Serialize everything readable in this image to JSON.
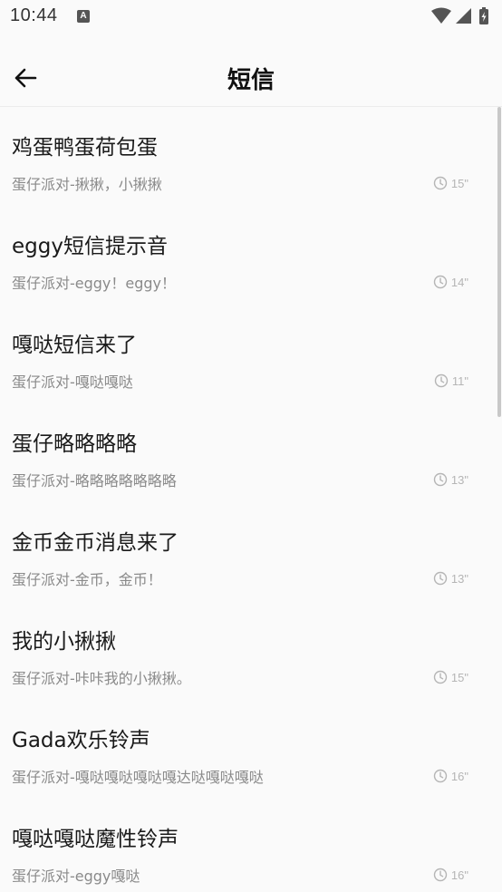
{
  "status_bar": {
    "time": "10:44",
    "notification_icon_letter": "A",
    "icons": [
      "wifi-icon",
      "cellular-signal-icon",
      "battery-charging-icon"
    ]
  },
  "app_bar": {
    "back_icon": "arrow-left-icon",
    "title": "短信"
  },
  "ringtones": [
    {
      "title": "鸡蛋鸭蛋荷包蛋",
      "subtitle": "蛋仔派对-揪揪，小揪揪",
      "duration": "15\""
    },
    {
      "title": "eggy短信提示音",
      "subtitle": "蛋仔派对-eggy！eggy！",
      "duration": "14\""
    },
    {
      "title": "嘎哒短信来了",
      "subtitle": "蛋仔派对-嘎哒嘎哒",
      "duration": "11\""
    },
    {
      "title": "蛋仔略略略略",
      "subtitle": "蛋仔派对-略略略略略略略",
      "duration": "13\""
    },
    {
      "title": "金币金币消息来了",
      "subtitle": "蛋仔派对-金币，金币！",
      "duration": "13\""
    },
    {
      "title": "我的小揪揪",
      "subtitle": "蛋仔派对-咔咔我的小揪揪。",
      "duration": "15\""
    },
    {
      "title": "Gada欢乐铃声",
      "subtitle": "蛋仔派对-嘎哒嘎哒嘎哒嘎达哒嘎哒嘎哒",
      "duration": "16\""
    },
    {
      "title": "嘎哒嘎哒魔性铃声",
      "subtitle": "蛋仔派对-eggy嘎哒",
      "duration": "16\""
    }
  ],
  "colors": {
    "background": "#fafafa",
    "title_text": "#1a1a1a",
    "subtitle_text": "#8a8a8a",
    "duration_text": "#b5b5b5",
    "scrollbar": "#c8c8c8"
  }
}
